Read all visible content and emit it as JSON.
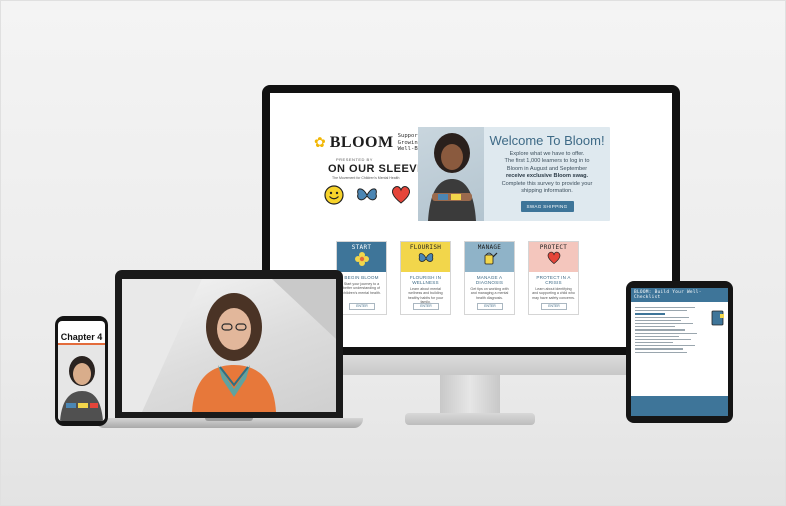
{
  "site": {
    "logo_word": "BLOOM",
    "tagline": "Supporting You In Growing Kids' Mental Well-Being",
    "presented_by": "PRESENTED BY",
    "partner": "ON OUR SLEEVES",
    "partner_sub": "The Movement for Children's Mental Health"
  },
  "hero": {
    "title": "Welcome To Bloom!",
    "line1": "Explore what we have to offer.",
    "line2": "The first 1,000 learners to log in to",
    "line3": "Bloom in August and September",
    "bold": "receive exclusive Bloom swag.",
    "line4": "Complete this survey to provide your",
    "line5": "shipping information.",
    "button": "SWAG SHIPPING"
  },
  "cards": [
    {
      "head": "START",
      "title": "BEGIN  BLOOM",
      "desc": "Start your journey to a better understanding of children's mental health.",
      "enter": "ENTER",
      "color": "#3e7599",
      "icon": "flower-icon"
    },
    {
      "head": "FLOURISH",
      "title": "FLOURISH IN WELLNESS",
      "desc": "Learn about mental wellness and building healthy habits for your family.",
      "enter": "ENTER",
      "color": "#f2d64b",
      "icon": "butterfly-icon"
    },
    {
      "head": "MANAGE",
      "title": "MANAGE A DIAGNOSIS",
      "desc": "Get tips on working with and managing a mental health diagnosis.",
      "enter": "ENTER",
      "color": "#8fb3c8",
      "icon": "watering-can-icon"
    },
    {
      "head": "PROTECT",
      "title": "PROTECT IN A CRISIS",
      "desc": "Learn about identifying and supporting a child who may have safety concerns.",
      "enter": "ENTER",
      "color": "#f4c6bd",
      "icon": "heart-icon"
    }
  ],
  "phone": {
    "chapter": "Chapter 4"
  },
  "tablet": {
    "header": "BLOOM: Build Your Well-Checklist"
  },
  "colors": {
    "accent": "#3e7599",
    "yellow": "#f2d64b",
    "red": "#e5453a",
    "bee": "#f2b705"
  }
}
